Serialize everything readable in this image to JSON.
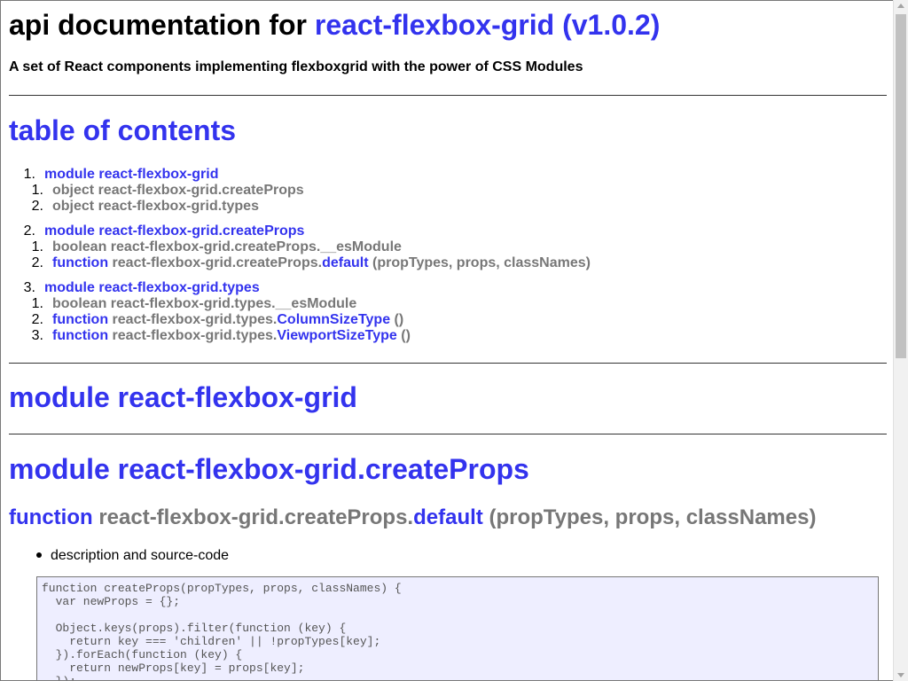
{
  "header": {
    "title_prefix": "api documentation for",
    "title_link": "react-flexbox-grid (v1.0.2)",
    "subtitle": "A set of React components implementing flexboxgrid with the power of CSS Modules"
  },
  "toc": {
    "heading": "table of contents",
    "modules": [
      {
        "num": "1.",
        "label": "module react-flexbox-grid",
        "items": [
          {
            "num": "1.",
            "type": "object",
            "name": "react-flexbox-grid.createProps",
            "link": "",
            "args": ""
          },
          {
            "num": "2.",
            "type": "object",
            "name": "react-flexbox-grid.types",
            "link": "",
            "args": ""
          }
        ]
      },
      {
        "num": "2.",
        "label": "module react-flexbox-grid.createProps",
        "items": [
          {
            "num": "1.",
            "type": "boolean",
            "name": "react-flexbox-grid.createProps.__esModule",
            "link": "",
            "args": ""
          },
          {
            "num": "2.",
            "type": "function",
            "name": "react-flexbox-grid.createProps.",
            "link": "default",
            "args": "(propTypes, props, classNames)"
          }
        ]
      },
      {
        "num": "3.",
        "label": "module react-flexbox-grid.types",
        "items": [
          {
            "num": "1.",
            "type": "boolean",
            "name": "react-flexbox-grid.types.__esModule",
            "link": "",
            "args": ""
          },
          {
            "num": "2.",
            "type": "function",
            "name": "react-flexbox-grid.types.",
            "link": "ColumnSizeType",
            "args": "()"
          },
          {
            "num": "3.",
            "type": "function",
            "name": "react-flexbox-grid.types.",
            "link": "ViewportSizeType",
            "args": "()"
          }
        ]
      }
    ]
  },
  "sections": {
    "module1": "module react-flexbox-grid",
    "module2": "module react-flexbox-grid.createProps"
  },
  "function_heading": {
    "type": "function",
    "name": "react-flexbox-grid.createProps.",
    "link": "default",
    "args": "(propTypes, props, classNames)"
  },
  "description_label": "description and source-code",
  "code": "function createProps(propTypes, props, classNames) {\n  var newProps = {};\n\n  Object.keys(props).filter(function (key) {\n    return key === 'children' || !propTypes[key];\n  }).forEach(function (key) {\n    return newProps[key] = props[key];\n  });",
  "colors": {
    "link": "#3333ee",
    "muted": "#777777",
    "code_bg": "#eeeeff"
  }
}
